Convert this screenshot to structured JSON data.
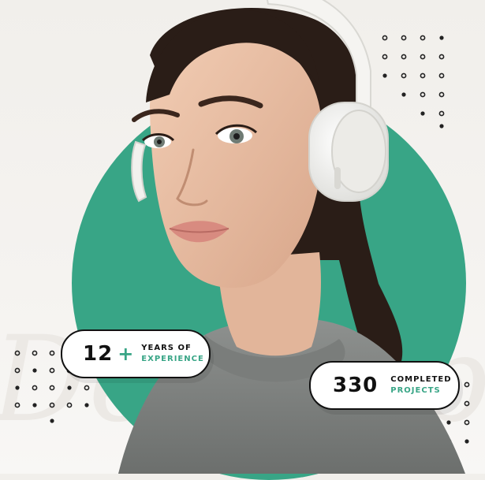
{
  "watermark": {
    "text": "Develop"
  },
  "colors": {
    "accent": "#38a586",
    "ink": "#111111",
    "background": "#f3f1ee"
  },
  "stats": [
    {
      "number": "12",
      "suffix": "+",
      "line1": "YEARS OF",
      "line2": "EXPERIENCE"
    },
    {
      "number": "330",
      "suffix": "",
      "line1": "COMPLETED",
      "line2": "PROJECTS"
    }
  ],
  "portrait": {
    "icon": "woman-with-headphones-photo"
  }
}
